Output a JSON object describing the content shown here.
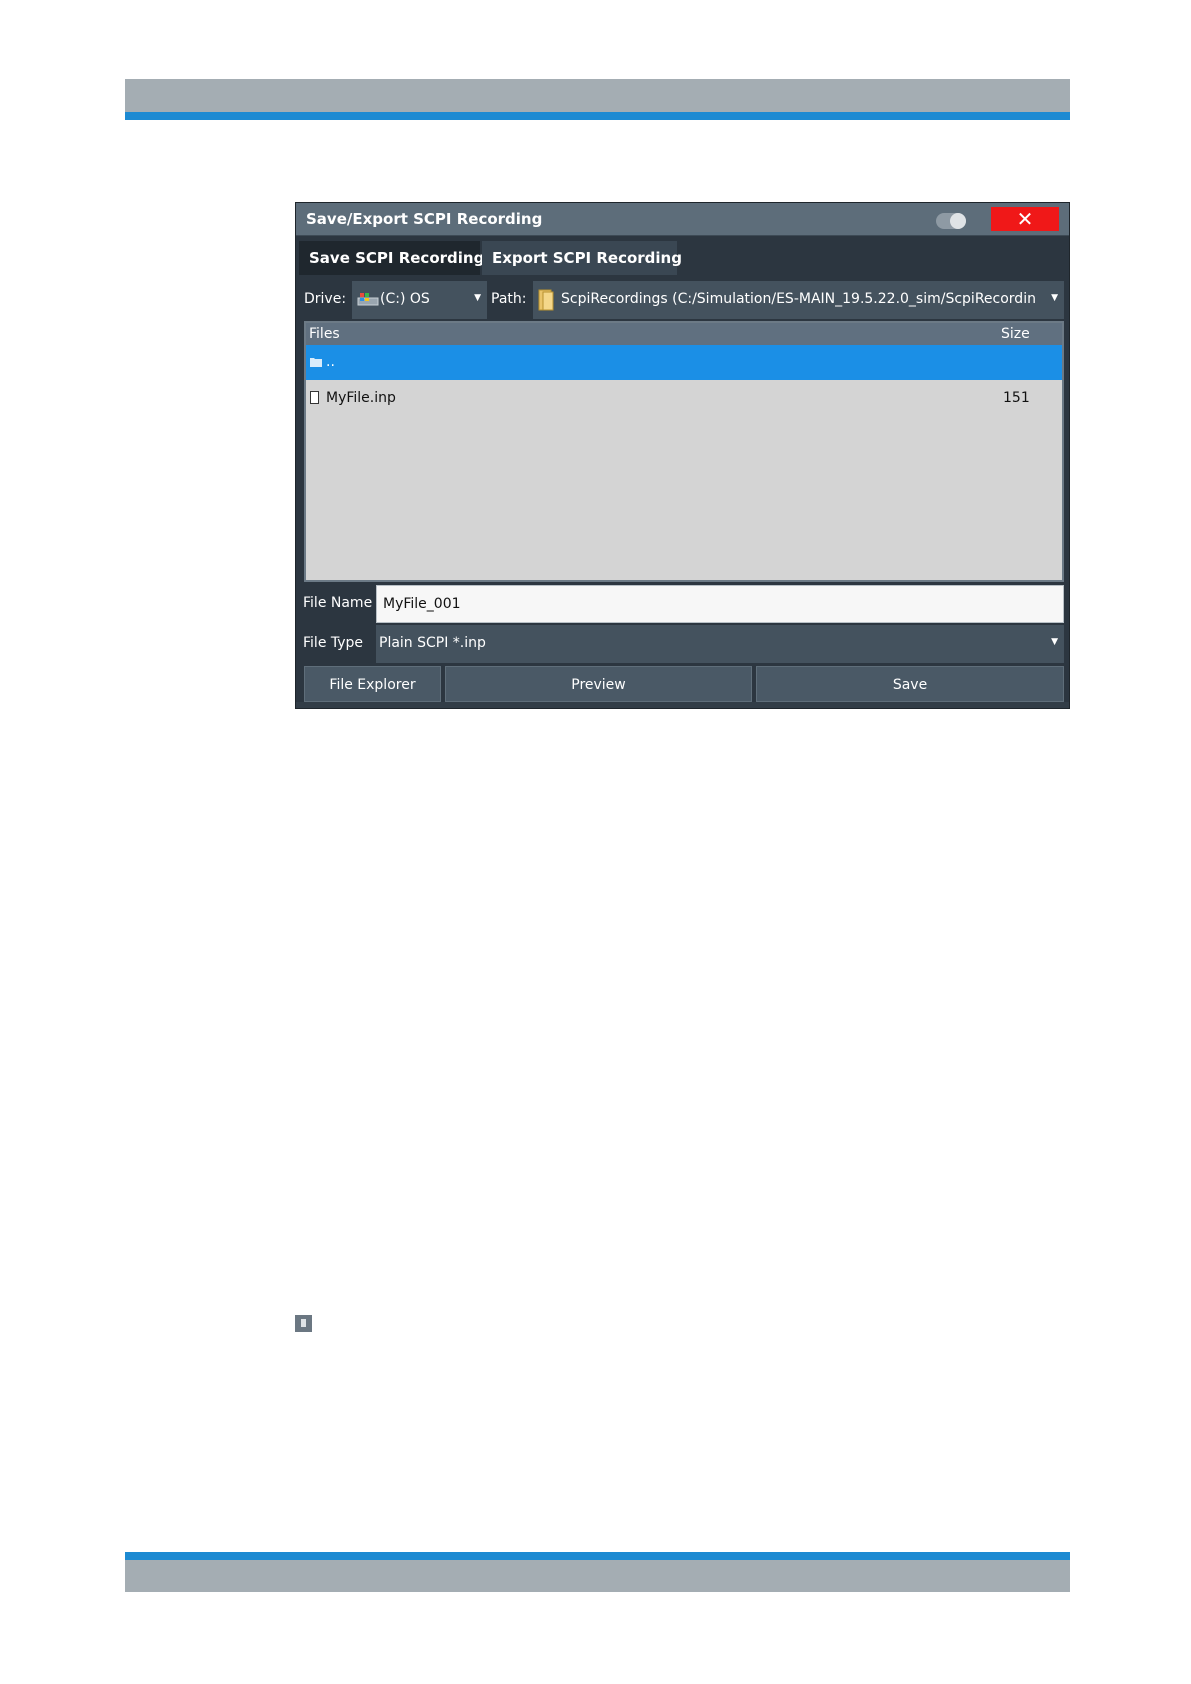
{
  "dialog": {
    "title": "Save/Export SCPI Recording",
    "close_symbol": "✕"
  },
  "tabs": [
    {
      "label": "Save SCPI Recording"
    },
    {
      "label": "Export SCPI Recording"
    }
  ],
  "drive": {
    "label": "Drive:",
    "value": "(C:) OS"
  },
  "path": {
    "label": "Path:",
    "value": "ScpiRecordings (C:/Simulation/ES-MAIN_19.5.22.0_sim/ScpiRecordin"
  },
  "file_list": {
    "columns": {
      "files": "Files",
      "size": "Size"
    },
    "rows": [
      {
        "name": "..",
        "size": "",
        "icon": "folder-icon",
        "selected": true
      },
      {
        "name": "MyFile.inp",
        "size": "151",
        "icon": "file-icon",
        "selected": false
      }
    ]
  },
  "file_name": {
    "label": "File Name",
    "value": "MyFile_001"
  },
  "file_type": {
    "label": "File Type",
    "value": "Plain SCPI *.inp"
  },
  "buttons": {
    "file_explorer": "File Explorer",
    "preview": "Preview",
    "save": "Save"
  },
  "colors": {
    "accent_blue": "#1d8ad2",
    "selection": "#1b8fe6",
    "close_red": "#f01818",
    "dialog_bg": "#2c3640"
  }
}
